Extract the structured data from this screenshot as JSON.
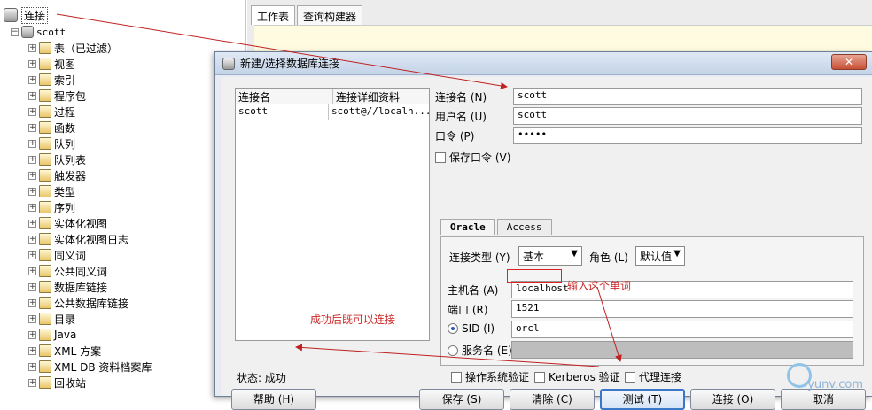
{
  "tree": {
    "connection_label": "连接",
    "scott_node": "scott",
    "items": [
      "表（已过滤）",
      "视图",
      "索引",
      "程序包",
      "过程",
      "函数",
      "队列",
      "队列表",
      "触发器",
      "类型",
      "序列",
      "实体化视图",
      "实体化视图日志",
      "同义词",
      "公共同义词",
      "数据库链接",
      "公共数据库链接",
      "目录",
      "Java",
      "XML 方案",
      "XML DB 资料档案库",
      "回收站"
    ]
  },
  "worksheet": {
    "tabs": [
      "工作表",
      "查询构建器"
    ]
  },
  "dialog": {
    "title": "新建/选择数据库连接",
    "close": "✕",
    "list": {
      "headers": [
        "连接名",
        "连接详细资料"
      ],
      "rows": [
        {
          "name": "scott",
          "detail": "scott@//localh..."
        }
      ]
    },
    "fields": {
      "conn_name_label": "连接名 (N)",
      "conn_name_value": "scott",
      "user_label": "用户名 (U)",
      "user_value": "scott",
      "pwd_label": "口令 (P)",
      "pwd_value": "•••••",
      "save_pwd_label": "保存口令 (V)"
    },
    "tabs": [
      "Oracle",
      "Access"
    ],
    "oracle": {
      "conn_type_label": "连接类型 (Y)",
      "conn_type_value": "基本",
      "role_label": "角色 (L)",
      "role_value": "默认值",
      "host_label": "主机名 (A)",
      "host_value": "localhost",
      "port_label": "端口 (R)",
      "port_value": "1521",
      "sid_label": "SID (I)",
      "sid_value": "orcl",
      "service_label": "服务名 (E)",
      "os_auth_label": "操作系统验证",
      "kerberos_label": "Kerberos 验证",
      "proxy_label": "代理连接"
    },
    "status_label": "状态:",
    "status_value": "成功",
    "buttons": {
      "help": "帮助 (H)",
      "save": "保存 (S)",
      "clear": "清除 (C)",
      "test": "测试 (T)",
      "connect": "连接 (O)",
      "cancel": "取消"
    },
    "annotations": {
      "after_success": "成功后既可以连接",
      "enter_word": "输入这个单词"
    }
  },
  "watermark": "iyunv.com"
}
